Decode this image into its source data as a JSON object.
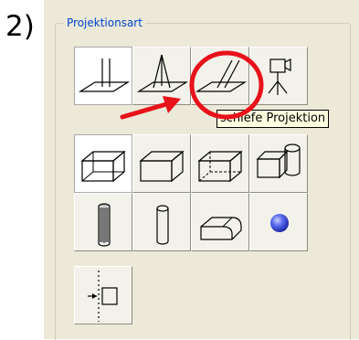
{
  "step_number": "2)",
  "group": {
    "title": "Projektionsart",
    "title_color": "#0046d5"
  },
  "tooltip": {
    "text": "schiefe Projektion"
  },
  "tools": [
    {
      "icon": "orthogonal-projection-icon",
      "selected": true
    },
    {
      "icon": "central-projection-icon",
      "selected": false
    },
    {
      "icon": "oblique-projection-icon",
      "selected": false
    },
    {
      "icon": "camera-tripod-icon",
      "selected": false
    },
    {
      "icon": "box-solid-icon",
      "selected": true
    },
    {
      "icon": "box-icon",
      "selected": false
    },
    {
      "icon": "box-hidden-lines-icon",
      "selected": false
    },
    {
      "icon": "box-with-cylinder-icon",
      "selected": false
    },
    {
      "icon": "cylinder-shaded-icon",
      "selected": false
    },
    {
      "icon": "cylinder-icon",
      "selected": false
    },
    {
      "icon": "rounded-block-icon",
      "selected": false
    },
    {
      "icon": "sphere-icon",
      "selected": false
    },
    {
      "icon": "section-cut-icon",
      "selected": false
    }
  ],
  "annotation_colors": {
    "circle": "#e8121b",
    "arrow": "#e8121b",
    "sphere": "#3f52e0"
  }
}
